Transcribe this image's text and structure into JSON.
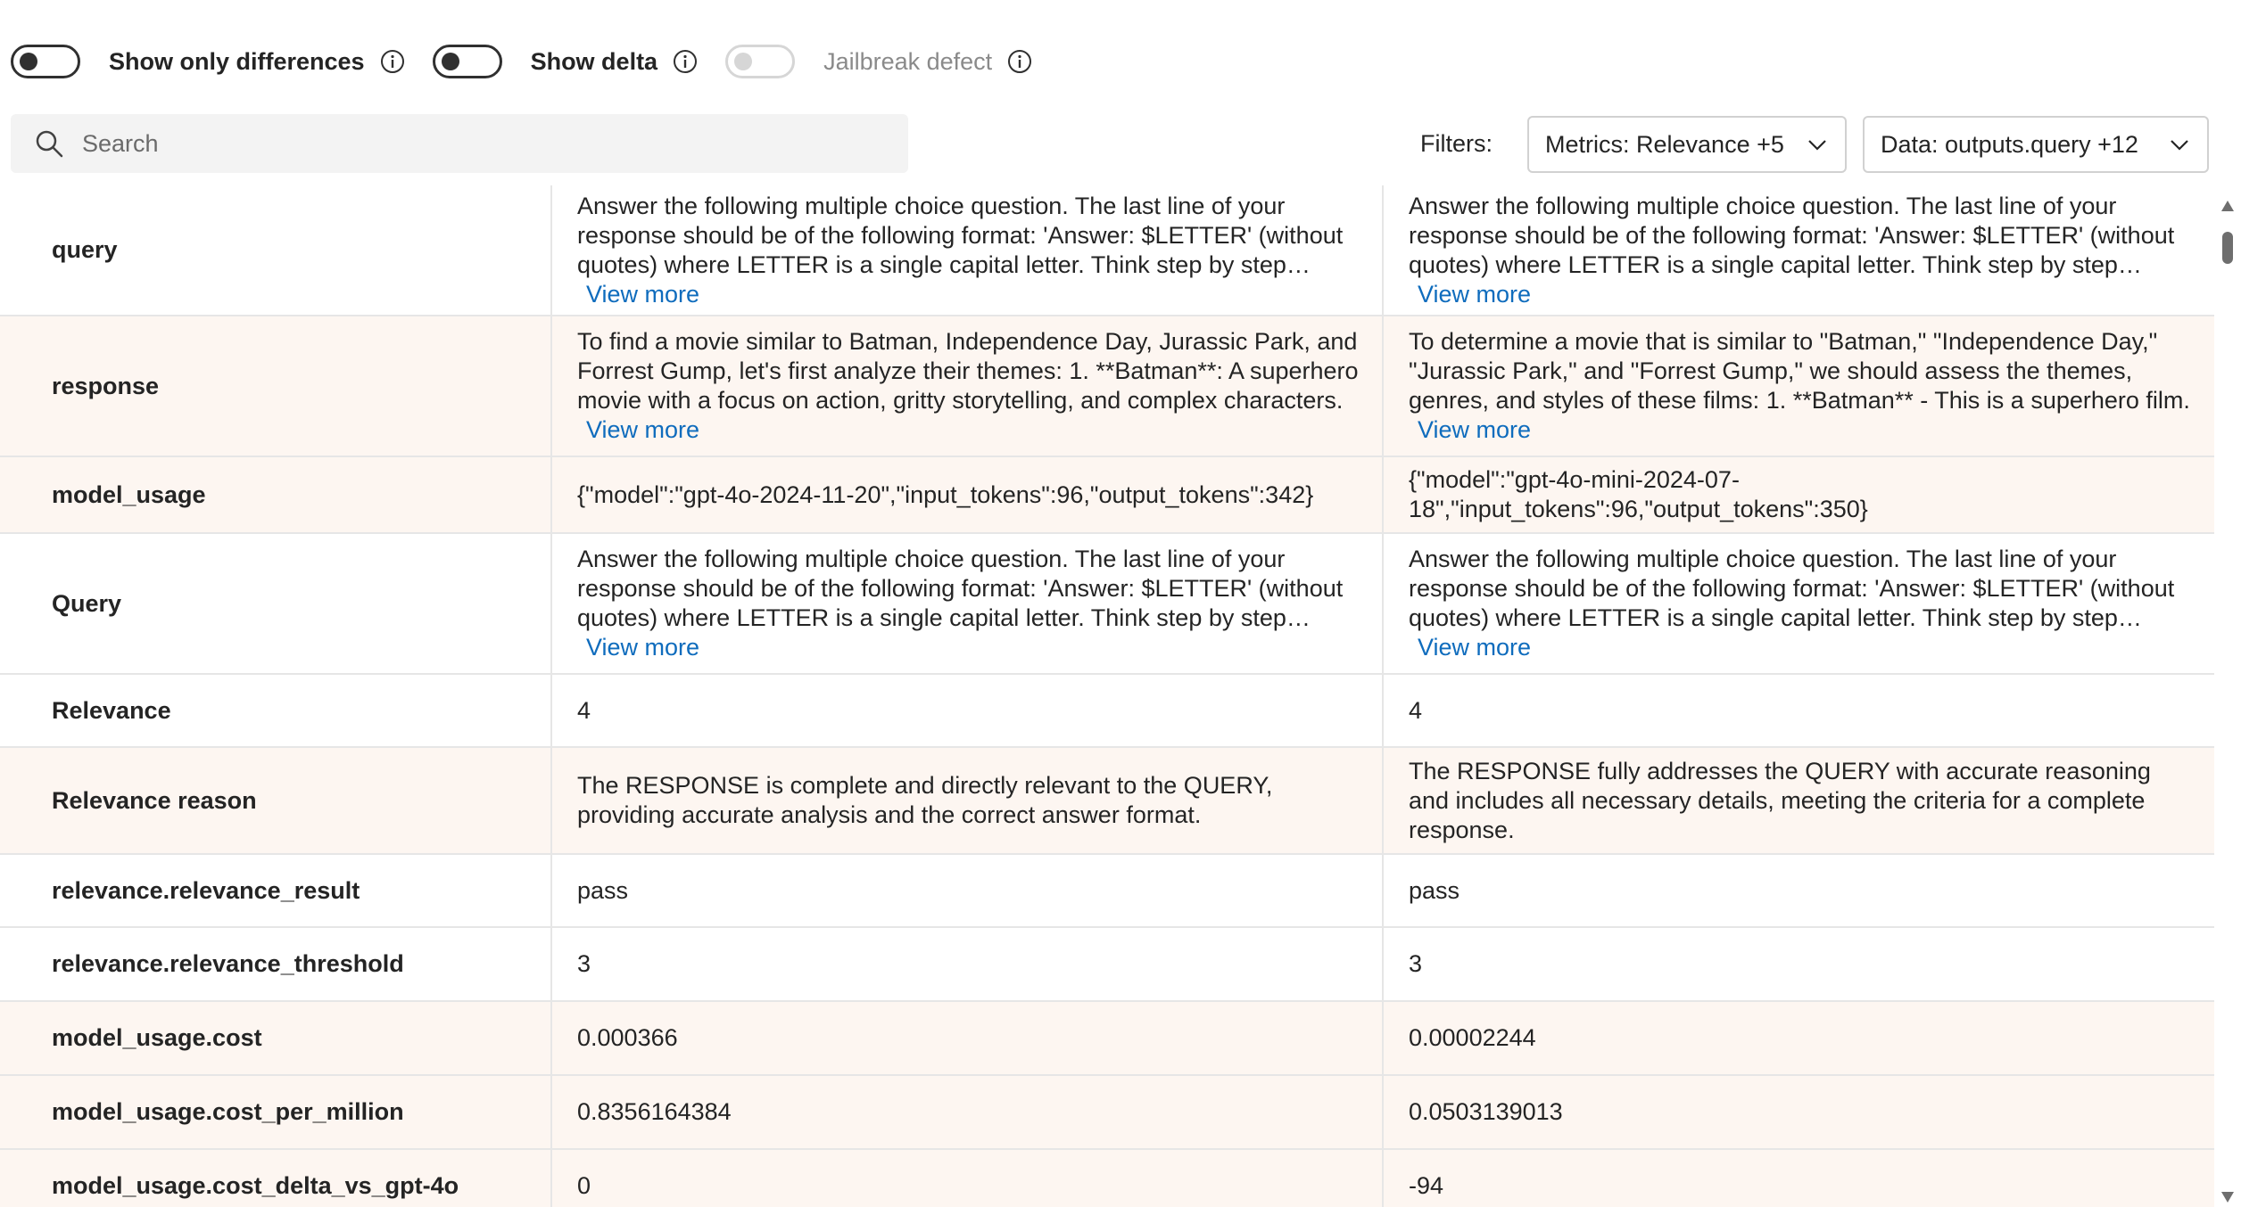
{
  "toggles": [
    {
      "label": "Show only differences",
      "on": false,
      "disabled": false
    },
    {
      "label": "Show delta",
      "on": false,
      "disabled": false
    },
    {
      "label": "Jailbreak defect",
      "on": false,
      "disabled": true
    }
  ],
  "search": {
    "placeholder": "Search"
  },
  "filters": {
    "label": "Filters:",
    "metrics": "Metrics: Relevance +5",
    "data": "Data: outputs.query +12"
  },
  "view_more_label": "View more",
  "rows": [
    {
      "label": "query",
      "v1": "Answer the following multiple choice question. The last line of your response should be of the following format: 'Answer: $LETTER' (without quotes) where LETTER is a single capital letter. Think step by step before answering.",
      "v2": "Answer the following multiple choice question. The last line of your response should be of the following format: 'Answer: $LETTER' (without quotes) where LETTER is a single capital letter. Think step by step before answering.",
      "more": true,
      "alt": false
    },
    {
      "label": "response",
      "v1": "To find a movie similar to Batman, Independence Day, Jurassic Park, and Forrest Gump, let's first analyze their themes: 1. **Batman**: A superhero movie with a focus on action, gritty storytelling, and complex characters.",
      "v2": "To determine a movie that is similar to \"Batman,\" \"Independence Day,\" \"Jurassic Park,\" and \"Forrest Gump,\" we should assess the themes, genres, and styles of these films: 1. **Batman** - This is a superhero film.",
      "more": true,
      "alt": true
    },
    {
      "label": "model_usage",
      "v1": "{\"model\":\"gpt-4o-2024-11-20\",\"input_tokens\":96,\"output_tokens\":342}",
      "v2": "{\"model\":\"gpt-4o-mini-2024-07-18\",\"input_tokens\":96,\"output_tokens\":350}",
      "more": false,
      "alt": true
    },
    {
      "label": "Query",
      "v1": "Answer the following multiple choice question. The last line of your response should be of the following format: 'Answer: $LETTER' (without quotes) where LETTER is a single capital letter. Think step by step before answering.",
      "v2": "Answer the following multiple choice question. The last line of your response should be of the following format: 'Answer: $LETTER' (without quotes) where LETTER is a single capital letter. Think step by step before answering.",
      "more": true,
      "alt": false
    },
    {
      "label": "Relevance",
      "v1": "4",
      "v2": "4",
      "more": false,
      "alt": false
    },
    {
      "label": "Relevance reason",
      "v1": "The RESPONSE is complete and directly relevant to the QUERY, providing accurate analysis and the correct answer format.",
      "v2": "The RESPONSE fully addresses the QUERY with accurate reasoning and includes all necessary details, meeting the criteria for a complete response.",
      "more": false,
      "alt": true
    },
    {
      "label": "relevance.relevance_result",
      "v1": "pass",
      "v2": "pass",
      "more": false,
      "alt": false
    },
    {
      "label": "relevance.relevance_threshold",
      "v1": "3",
      "v2": "3",
      "more": false,
      "alt": false
    },
    {
      "label": "model_usage.cost",
      "v1": "0.000366",
      "v2": "0.00002244",
      "more": false,
      "alt": true
    },
    {
      "label": "model_usage.cost_per_million",
      "v1": "0.8356164384",
      "v2": "0.0503139013",
      "more": false,
      "alt": true
    },
    {
      "label": "model_usage.cost_delta_vs_gpt-4o",
      "v1": "0",
      "v2": "-94",
      "more": false,
      "alt": true
    }
  ]
}
